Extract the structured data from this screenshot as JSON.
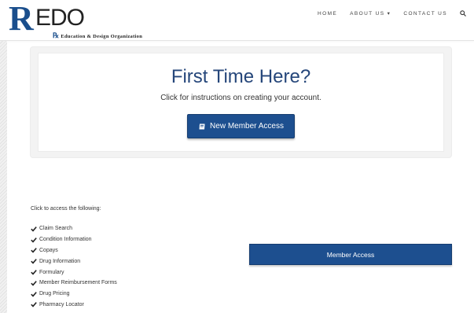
{
  "header": {
    "logo": {
      "mark": "R",
      "wordmark": "EDO",
      "tagline_rx": "℞",
      "tagline": "Education & Design Organization"
    },
    "nav": [
      {
        "label": "HOME"
      },
      {
        "label": "ABOUT US ▾"
      },
      {
        "label": "CONTACT US"
      }
    ],
    "search_icon": "search-icon"
  },
  "welcome": {
    "title": "First Time Here?",
    "subtitle": "Click for instructions on creating your account.",
    "button_label": "New Member Access",
    "button_icon": "book-icon"
  },
  "access": {
    "intro": "Click to access the following:",
    "items": [
      "Claim Search",
      "Condition Information",
      "Copays",
      "Drug Information",
      "Formulary",
      "Member Reimbursement Forms",
      "Drug Pricing",
      "Pharmacy Locator"
    ],
    "item_icon": "check-icon",
    "button_label": "Member Access"
  },
  "colors": {
    "brand_blue": "#1d4f8f",
    "title_blue": "#25467a"
  }
}
